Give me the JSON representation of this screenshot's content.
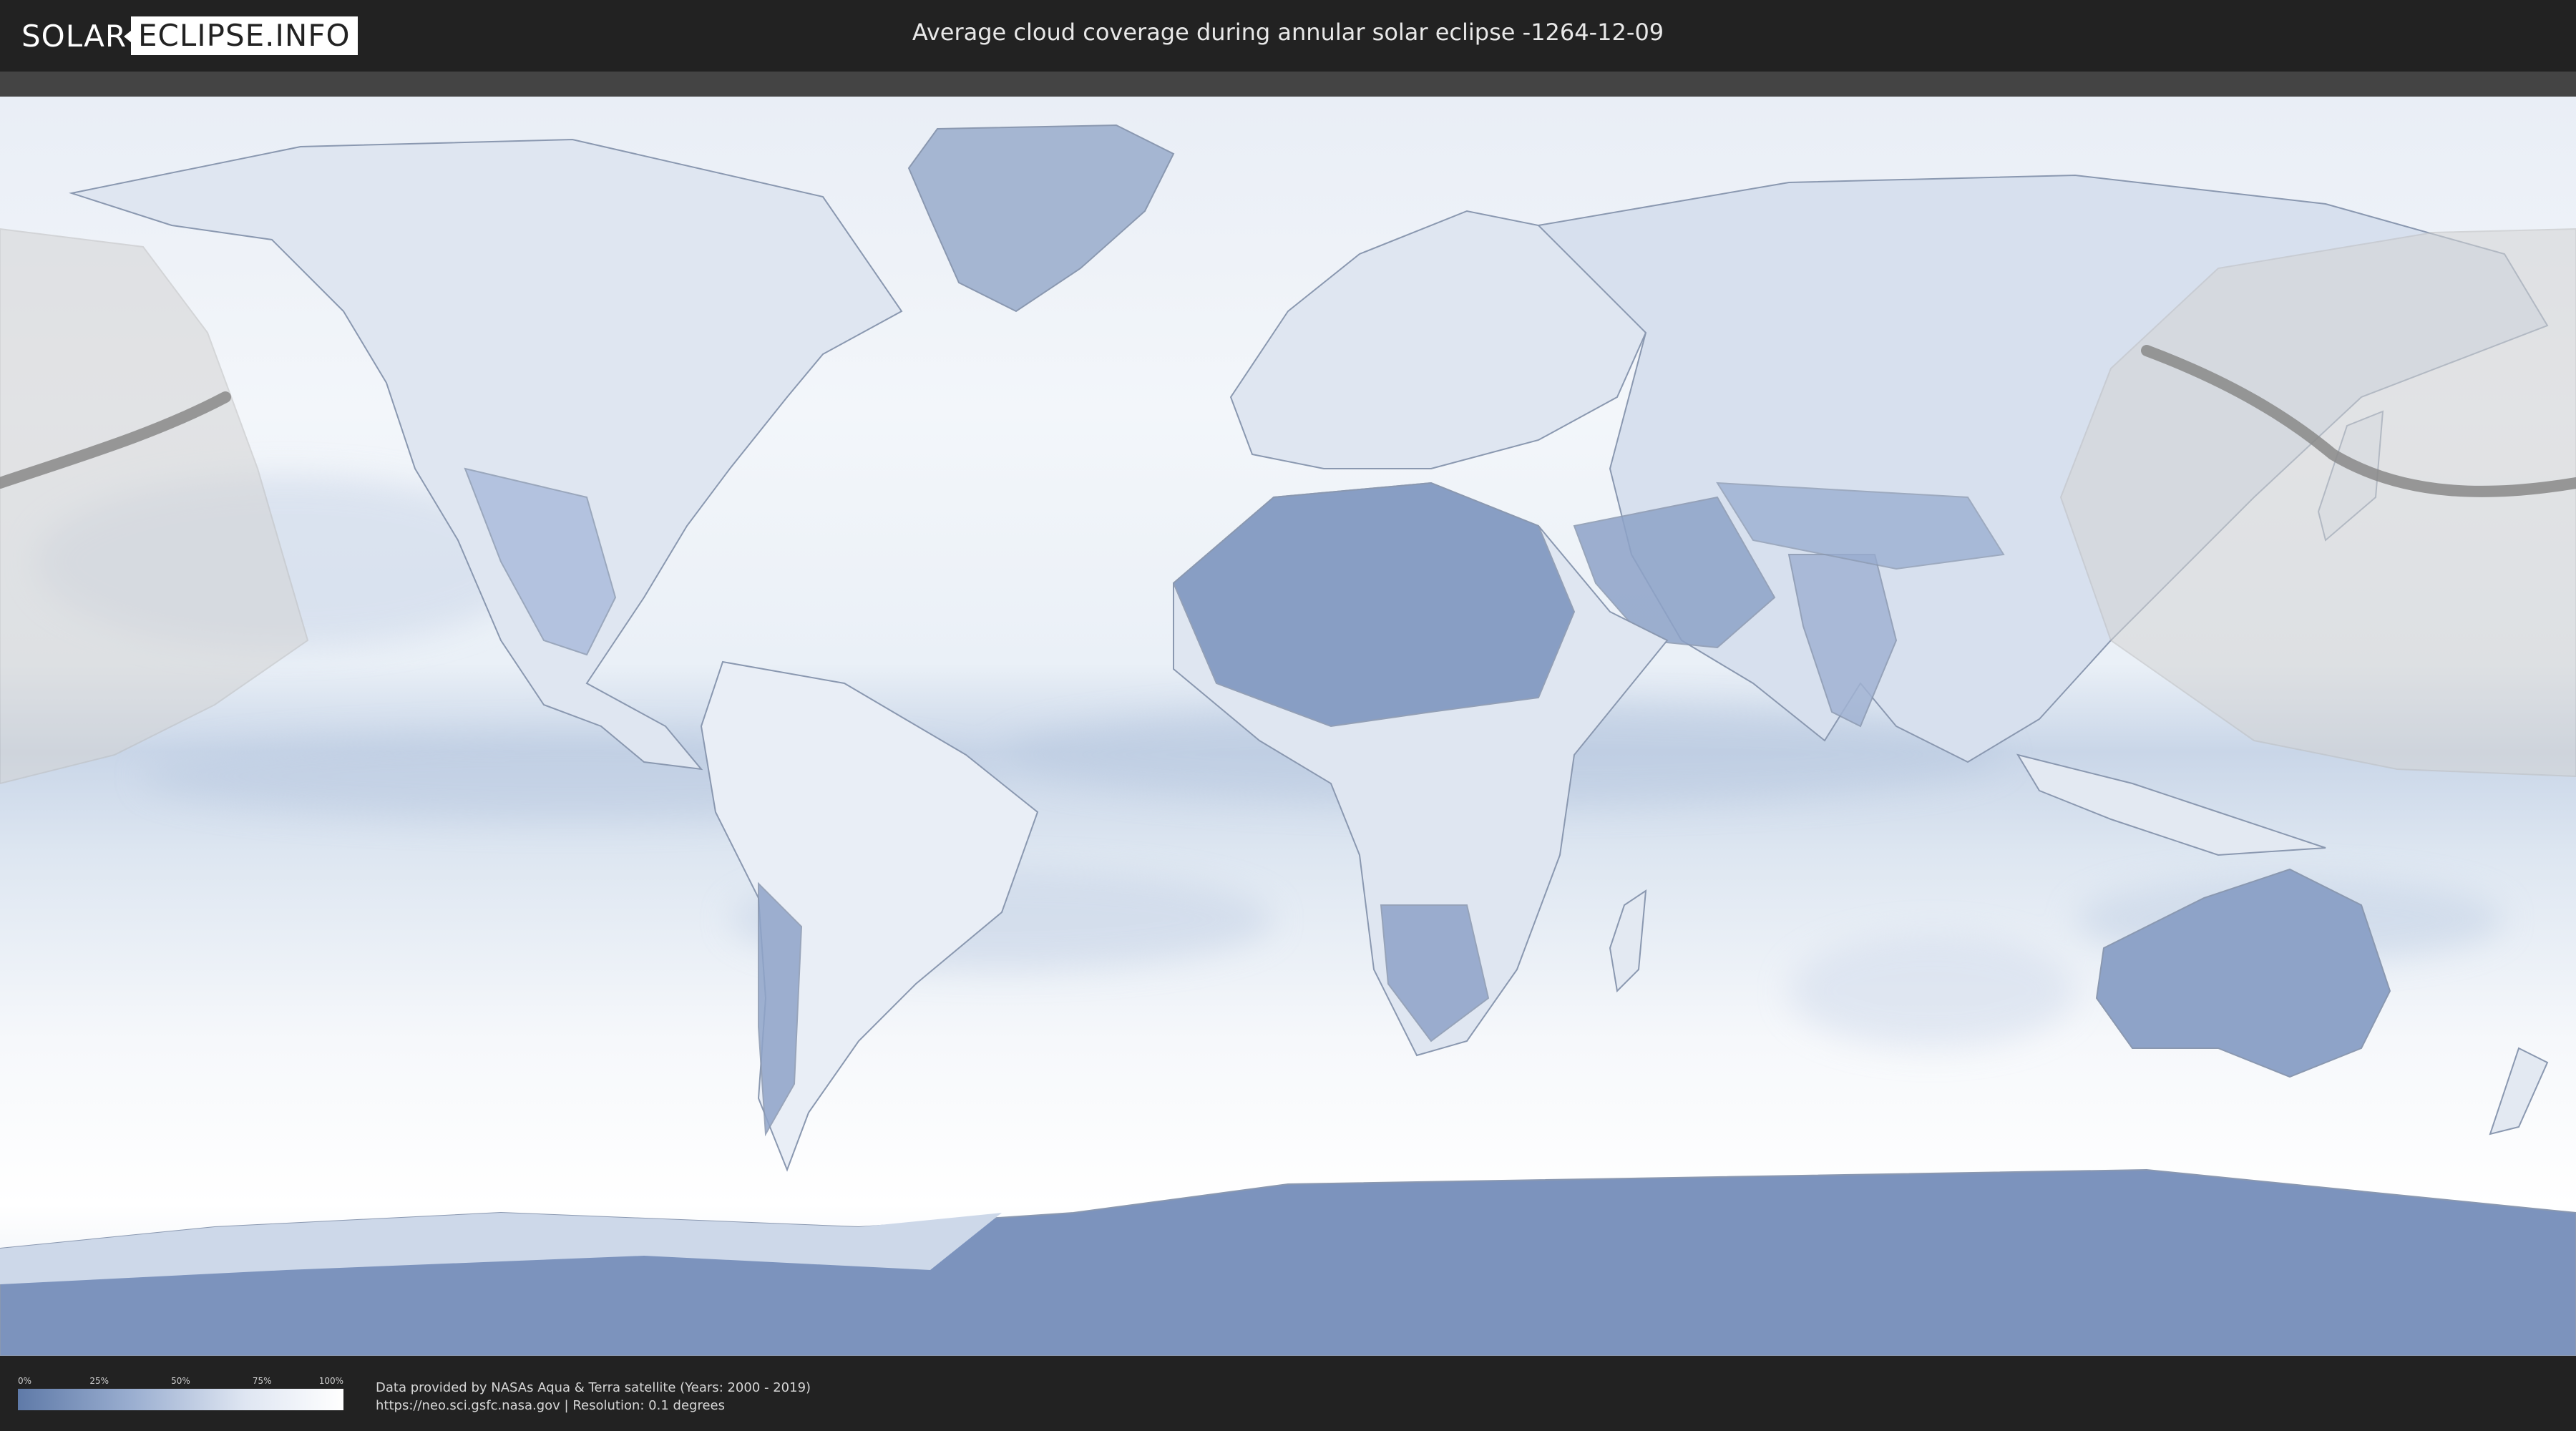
{
  "header": {
    "logo_left": "SOLAR",
    "logo_right": "ECLIPSE.INFO",
    "title": "Average cloud coverage during annular solar eclipse -1264-12-09"
  },
  "legend": {
    "ticks": [
      "0%",
      "25%",
      "50%",
      "75%",
      "100%"
    ],
    "color_low": "#5f7aa8",
    "color_high": "#ffffff"
  },
  "footer": {
    "credit_line1": "Data provided by NASAs Aqua & Terra satellite (Years: 2000 - 2019)",
    "credit_line2": "https://neo.sci.gsfc.nasa.gov | Resolution: 0.1 degrees"
  },
  "map": {
    "colors": {
      "ocean_cloudy": "#f4f7fb",
      "clear": "#7e96bf",
      "land_outline": "#8a98b0",
      "eclipse_path": "#888888",
      "visibility_zone": "#d8d8d8"
    },
    "icons": [
      "eclipse-path-line",
      "visibility-zone"
    ]
  }
}
